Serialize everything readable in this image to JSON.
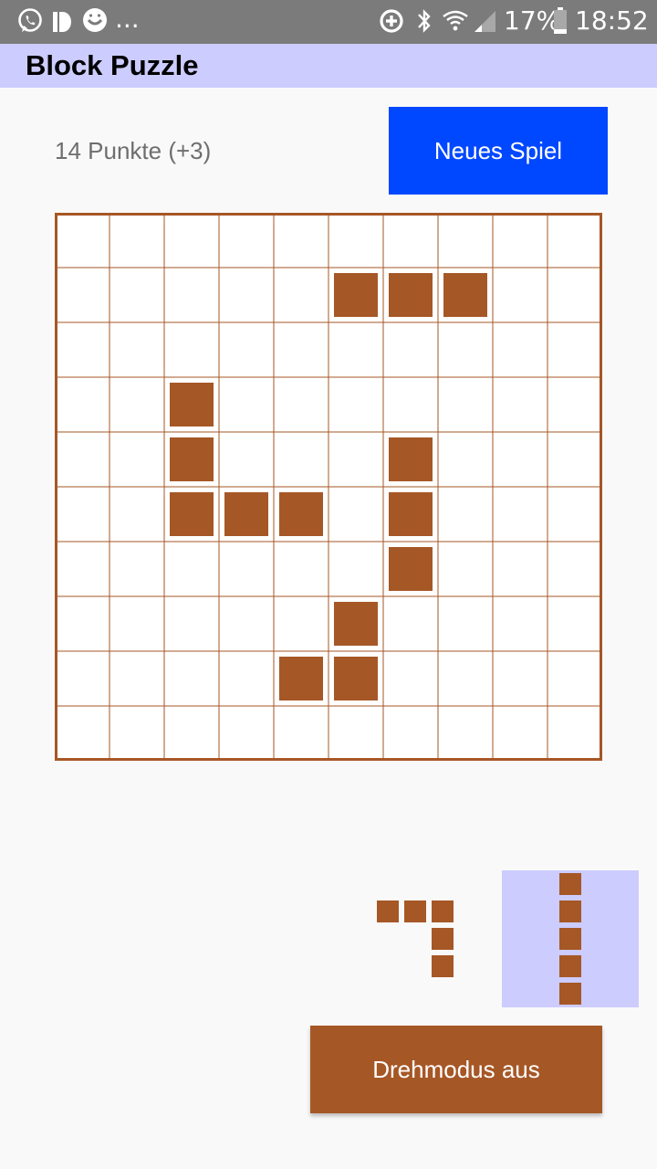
{
  "status_bar": {
    "left_icons": [
      "whatsapp-icon",
      "deezer-icon",
      "emoji-icon"
    ],
    "overflow": "...",
    "right_icons": [
      "data-saver-icon",
      "bluetooth-icon",
      "wifi-icon",
      "signal-icon"
    ],
    "battery": "17%",
    "time": "18:52"
  },
  "app": {
    "title": "Block Puzzle"
  },
  "score": {
    "text": "14 Punkte (+3)"
  },
  "buttons": {
    "new_game": "Neues Spiel",
    "rotate_mode": "Drehmodus aus"
  },
  "colors": {
    "block": "#a65726",
    "grid_line": "#a65726",
    "primary_button": "#0048ff",
    "selected_bg": "#ccccff"
  },
  "board": {
    "rows": 10,
    "cols": 10,
    "filled": [
      [
        1,
        5
      ],
      [
        1,
        6
      ],
      [
        1,
        7
      ],
      [
        3,
        2
      ],
      [
        4,
        2
      ],
      [
        4,
        6
      ],
      [
        5,
        2
      ],
      [
        5,
        3
      ],
      [
        5,
        4
      ],
      [
        5,
        6
      ],
      [
        6,
        6
      ],
      [
        7,
        5
      ],
      [
        8,
        4
      ],
      [
        8,
        5
      ]
    ]
  },
  "tray": [
    {
      "name": "l-shape-piece",
      "selected": false,
      "cells": [
        [
          0,
          0
        ],
        [
          0,
          1
        ],
        [
          0,
          2
        ],
        [
          1,
          2
        ],
        [
          2,
          2
        ]
      ]
    },
    {
      "name": "i-shape-piece",
      "selected": true,
      "cells": [
        [
          0,
          0
        ],
        [
          1,
          0
        ],
        [
          2,
          0
        ],
        [
          3,
          0
        ],
        [
          4,
          0
        ]
      ]
    }
  ]
}
